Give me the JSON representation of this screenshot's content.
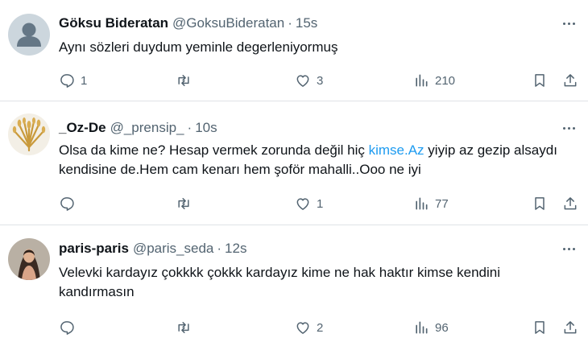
{
  "tweets": [
    {
      "name": "Göksu Bideratan",
      "handle": "@GoksuBideratan",
      "dot": "·",
      "time": "15s",
      "text": "Aynı sözleri duydum  yeminle degerleniyormuş",
      "reply_count": "1",
      "retweet_count": "",
      "like_count": "3",
      "view_count": "210"
    },
    {
      "name": "_Oz-De",
      "handle": "@_prensip_",
      "dot": "·",
      "time": "10s",
      "text_before": "Olsa da kime ne? Hesap vermek zorunda değil hiç ",
      "mention": "kimse.Az",
      "text_after": " yiyip az gezip alsaydı kendisine de.Hem cam kenarı hem şoför mahalli..Ooo ne iyi",
      "reply_count": "",
      "retweet_count": "",
      "like_count": "1",
      "view_count": "77"
    },
    {
      "name": "paris-paris",
      "handle": "@paris_seda",
      "dot": "·",
      "time": "12s",
      "text": "Velevki kardayız çokkkk çokkk kardayız kime ne hak haktır kimse kendini kandırmasın",
      "reply_count": "",
      "retweet_count": "",
      "like_count": "2",
      "view_count": "96"
    }
  ],
  "icons": {
    "reply": "reply-icon",
    "retweet": "retweet-icon",
    "like": "like-icon",
    "views": "views-icon",
    "bookmark": "bookmark-icon",
    "share": "share-icon",
    "more": "more-icon"
  },
  "colors": {
    "text": "#0f1419",
    "secondary": "#536471",
    "link": "#1d9bf0",
    "divider": "#dfe3e6"
  }
}
